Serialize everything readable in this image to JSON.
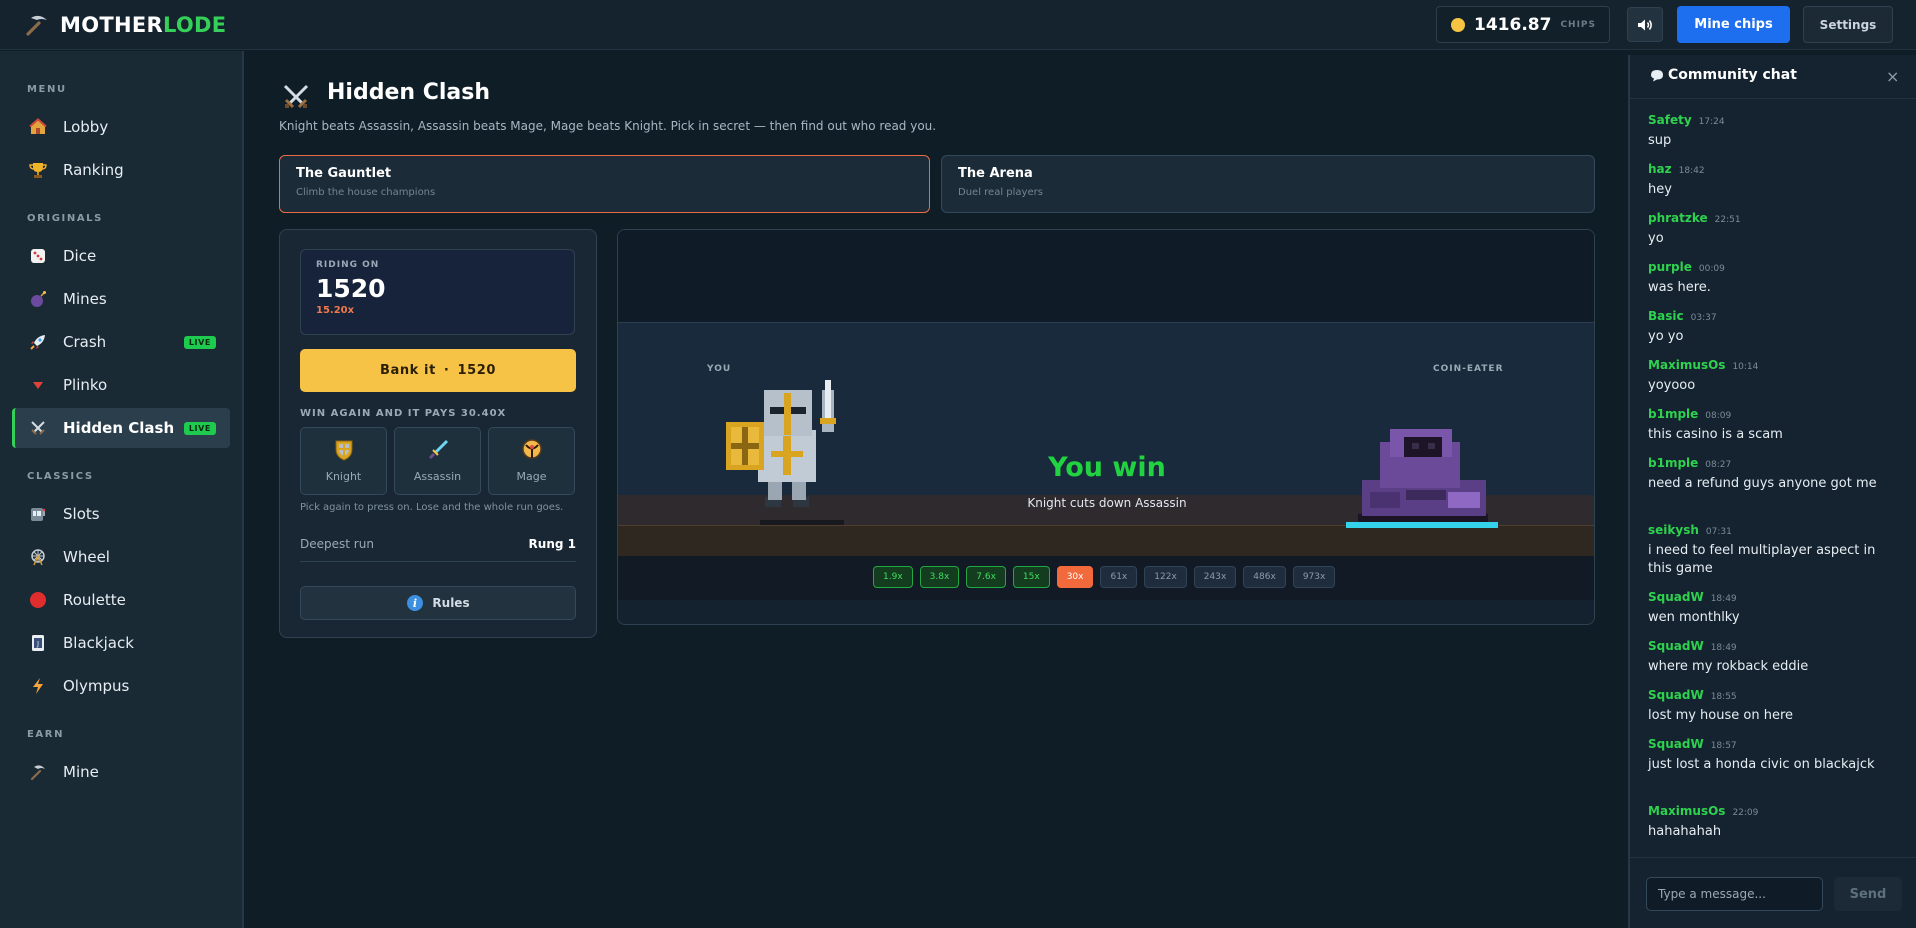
{
  "header": {
    "brand_a": "MOTHER",
    "brand_b": "LODE",
    "balance": "1416.87",
    "balance_unit": "CHIPS",
    "mine_button": "Mine chips",
    "settings_button": "Settings"
  },
  "sidebar": {
    "sections": [
      "MENU",
      "ORIGINALS",
      "CLASSICS",
      "EARN"
    ],
    "items": [
      {
        "label": "Lobby"
      },
      {
        "label": "Ranking"
      },
      {
        "label": "Dice"
      },
      {
        "label": "Mines"
      },
      {
        "label": "Crash",
        "badge": "LIVE"
      },
      {
        "label": "Plinko"
      },
      {
        "label": "Hidden Clash",
        "badge": "LIVE",
        "active": true
      },
      {
        "label": "Slots"
      },
      {
        "label": "Wheel"
      },
      {
        "label": "Roulette"
      },
      {
        "label": "Blackjack"
      },
      {
        "label": "Olympus"
      },
      {
        "label": "Mine"
      }
    ]
  },
  "game": {
    "title": "Hidden Clash",
    "subtitle": "Knight beats Assassin, Assassin beats Mage, Mage beats Knight. Pick in secret — then find out who read you.",
    "modes": [
      {
        "title": "The Gauntlet",
        "sub": "Climb the house champions",
        "active": true
      },
      {
        "title": "The Arena",
        "sub": "Duel real players",
        "active": false
      }
    ],
    "riding_label": "RIDING ON",
    "riding_value": "1520",
    "riding_mult": "15.20x",
    "bank_label": "Bank it",
    "bank_sep": "·",
    "bank_value": "1520",
    "win_again": "WIN AGAIN AND IT PAYS 30.40X",
    "picks": [
      {
        "label": "Knight",
        "icon": "shield-icon"
      },
      {
        "label": "Assassin",
        "icon": "dagger-icon"
      },
      {
        "label": "Mage",
        "icon": "staff-icon"
      }
    ],
    "pick_note": "Pick again to press on. Lose and the whole run goes.",
    "deepest_label": "Deepest run",
    "deepest_value": "Rung 1",
    "rules_label": "Rules",
    "rules_icon": "i",
    "arena": {
      "you_label": "YOU",
      "opponent_label": "COIN-EATER",
      "result": "You win",
      "result_detail": "Knight cuts down Assassin",
      "ladder": [
        {
          "label": "1.9x",
          "state": "done"
        },
        {
          "label": "3.8x",
          "state": "done"
        },
        {
          "label": "7.6x",
          "state": "done"
        },
        {
          "label": "15x",
          "state": "done"
        },
        {
          "label": "30x",
          "state": "current"
        },
        {
          "label": "61x",
          "state": "future"
        },
        {
          "label": "122x",
          "state": "future"
        },
        {
          "label": "243x",
          "state": "future"
        },
        {
          "label": "486x",
          "state": "future"
        },
        {
          "label": "973x",
          "state": "future"
        }
      ]
    }
  },
  "chat": {
    "title": "Community chat",
    "close": "×",
    "placeholder": "Type a message...",
    "send": "Send",
    "messages": [
      {
        "user": "Safety",
        "time": "17:24",
        "text": "sup"
      },
      {
        "user": "haz",
        "time": "18:42",
        "text": "hey"
      },
      {
        "user": "phratzke",
        "time": "22:51",
        "text": "yo"
      },
      {
        "user": "purple",
        "time": "00:09",
        "text": "was here."
      },
      {
        "user": "Basic",
        "time": "03:37",
        "text": "yo yo"
      },
      {
        "user": "MaximusOs",
        "time": "10:14",
        "text": "yoyooo"
      },
      {
        "user": "b1mple",
        "time": "08:09",
        "text": "this casino is a scam"
      },
      {
        "user": "b1mple",
        "time": "08:27",
        "text": "need a refund guys anyone got me"
      },
      {
        "user": "seikysh",
        "time": "07:31",
        "text": "i need to feel multiplayer aspect in this game"
      },
      {
        "user": "SquadW",
        "time": "18:49",
        "text": "wen monthlky"
      },
      {
        "user": "SquadW",
        "time": "18:49",
        "text": "where my rokback eddie"
      },
      {
        "user": "SquadW",
        "time": "18:55",
        "text": "lost my house on here"
      },
      {
        "user": "SquadW",
        "time": "18:57",
        "text": "just lost a honda civic on blackajck"
      },
      {
        "user": "MaximusOs",
        "time": "22:09",
        "text": "hahahahah"
      }
    ]
  },
  "colors": {
    "accent_green": "#34d058",
    "accent_blue": "#1e6ff0",
    "accent_orange": "#f26a3c",
    "bank_yellow": "#f7c347"
  }
}
